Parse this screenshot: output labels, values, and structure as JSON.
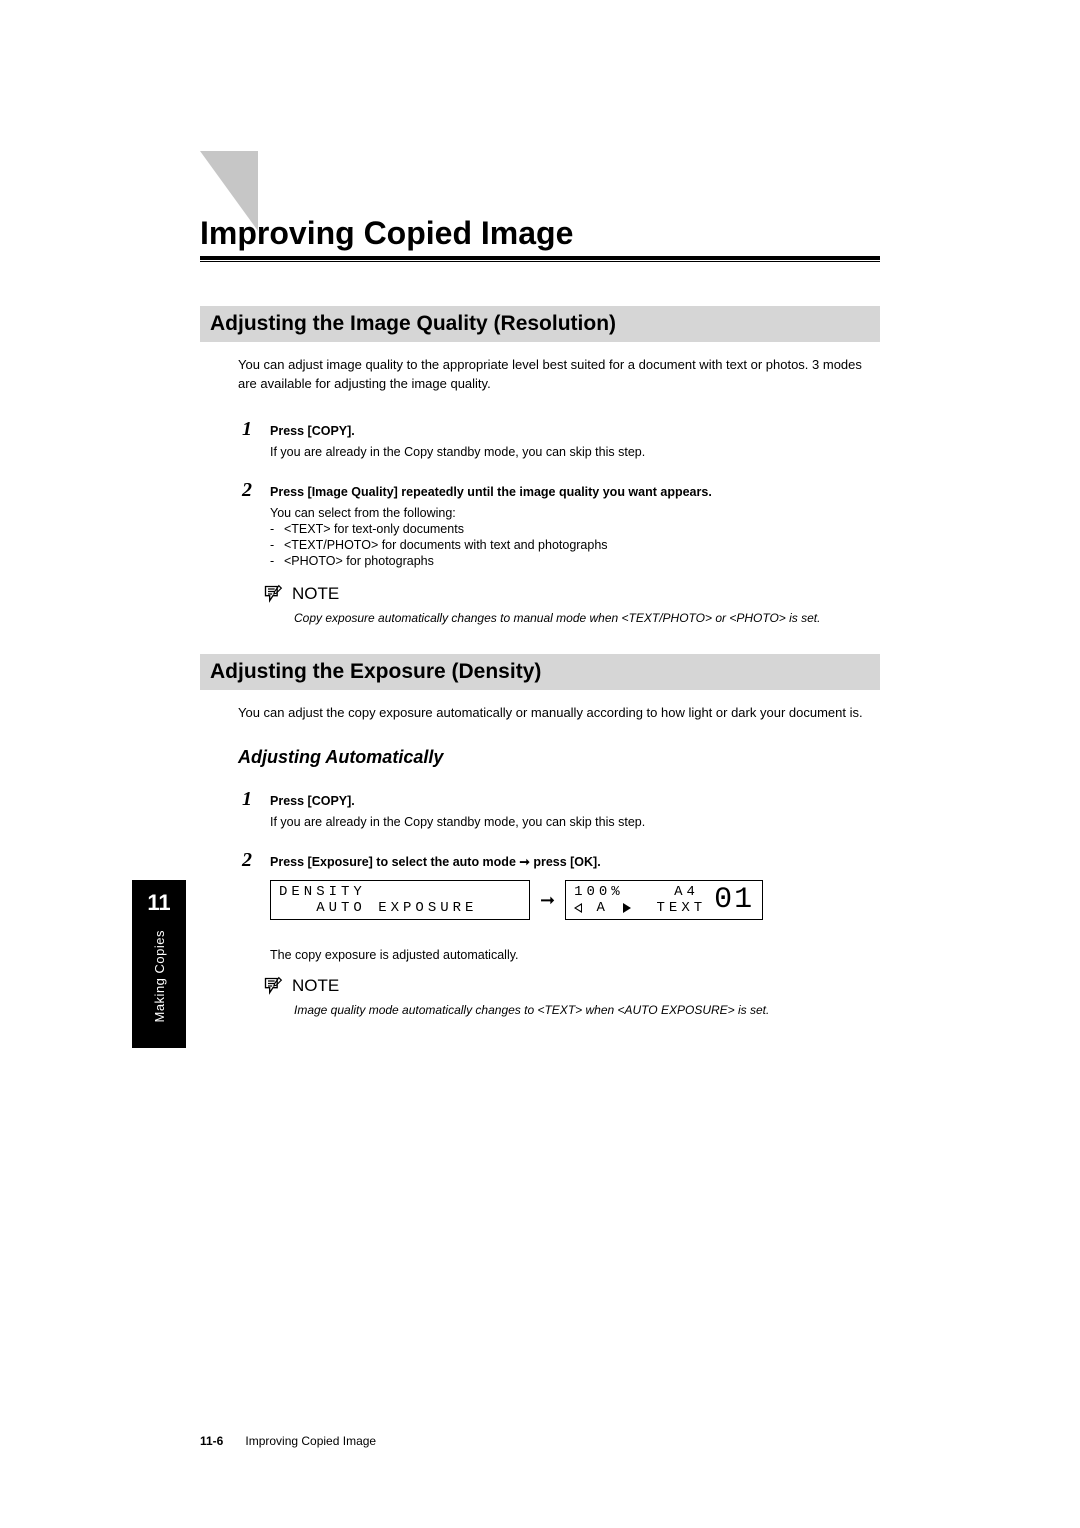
{
  "chapter": {
    "title": "Improving Copied Image",
    "number": "11",
    "tab_label": "Making Copies"
  },
  "section1": {
    "heading": "Adjusting the Image Quality (Resolution)",
    "intro": "You can adjust image quality to the appropriate level best suited for a document with text or photos. 3 modes are available for adjusting the image quality.",
    "steps": [
      {
        "num": "1",
        "title": "Press [COPY].",
        "note": "If you are already in the Copy standby mode, you can skip this step."
      },
      {
        "num": "2",
        "title": "Press [Image Quality] repeatedly until the image quality you want appears.",
        "subhead": "You can select from the following:",
        "items": [
          "<TEXT> for text-only documents",
          "<TEXT/PHOTO> for documents with text and photographs",
          "<PHOTO> for photographs"
        ]
      }
    ],
    "note_label": "NOTE",
    "note_body": "Copy exposure automatically changes to manual mode when <TEXT/PHOTO> or <PHOTO> is set."
  },
  "section2": {
    "heading": "Adjusting the Exposure (Density)",
    "intro": "You can adjust the copy exposure automatically or manually according to how light or dark your document is.",
    "subsection": "Adjusting Automatically",
    "steps": [
      {
        "num": "1",
        "title": "Press [COPY].",
        "note": "If you are already in the Copy standby mode, you can skip this step."
      },
      {
        "num": "2",
        "title": "Press [Exposure] to select the auto mode ➞ press [OK]."
      }
    ],
    "lcd": {
      "left_line1": "DENSITY",
      "left_line2": "   AUTO EXPOSURE",
      "right_top_left": "100%",
      "right_top_right": "A4",
      "right_bot_mid": "A",
      "right_bot_right": "TEXT",
      "big": "01"
    },
    "result": "The copy exposure is adjusted automatically.",
    "note_label": "NOTE",
    "note_body": "Image quality mode automatically changes to <TEXT> when <AUTO EXPOSURE> is set."
  },
  "footer": {
    "page": "11-6",
    "title": "Improving Copied Image"
  }
}
